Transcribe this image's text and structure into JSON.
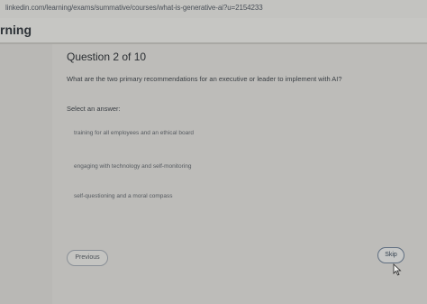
{
  "browser": {
    "url": "linkedin.com/learning/exams/summative/courses/what-is-generative-ai?u=2154233"
  },
  "header": {
    "brand_fragment": "rning"
  },
  "quiz": {
    "question_title": "Question 2 of 10",
    "question_text": "What are the two primary recommendations for an executive or leader to implement with AI?",
    "select_label": "Select an answer:",
    "options": [
      {
        "label": "training for all employees and an ethical board"
      },
      {
        "label": "engaging with technology and self-monitoring"
      },
      {
        "label": "self-questioning and a moral compass"
      }
    ],
    "previous_label": "Previous",
    "skip_label": "Skip"
  },
  "icons": {
    "cursor": "mouse-pointer-icon"
  }
}
